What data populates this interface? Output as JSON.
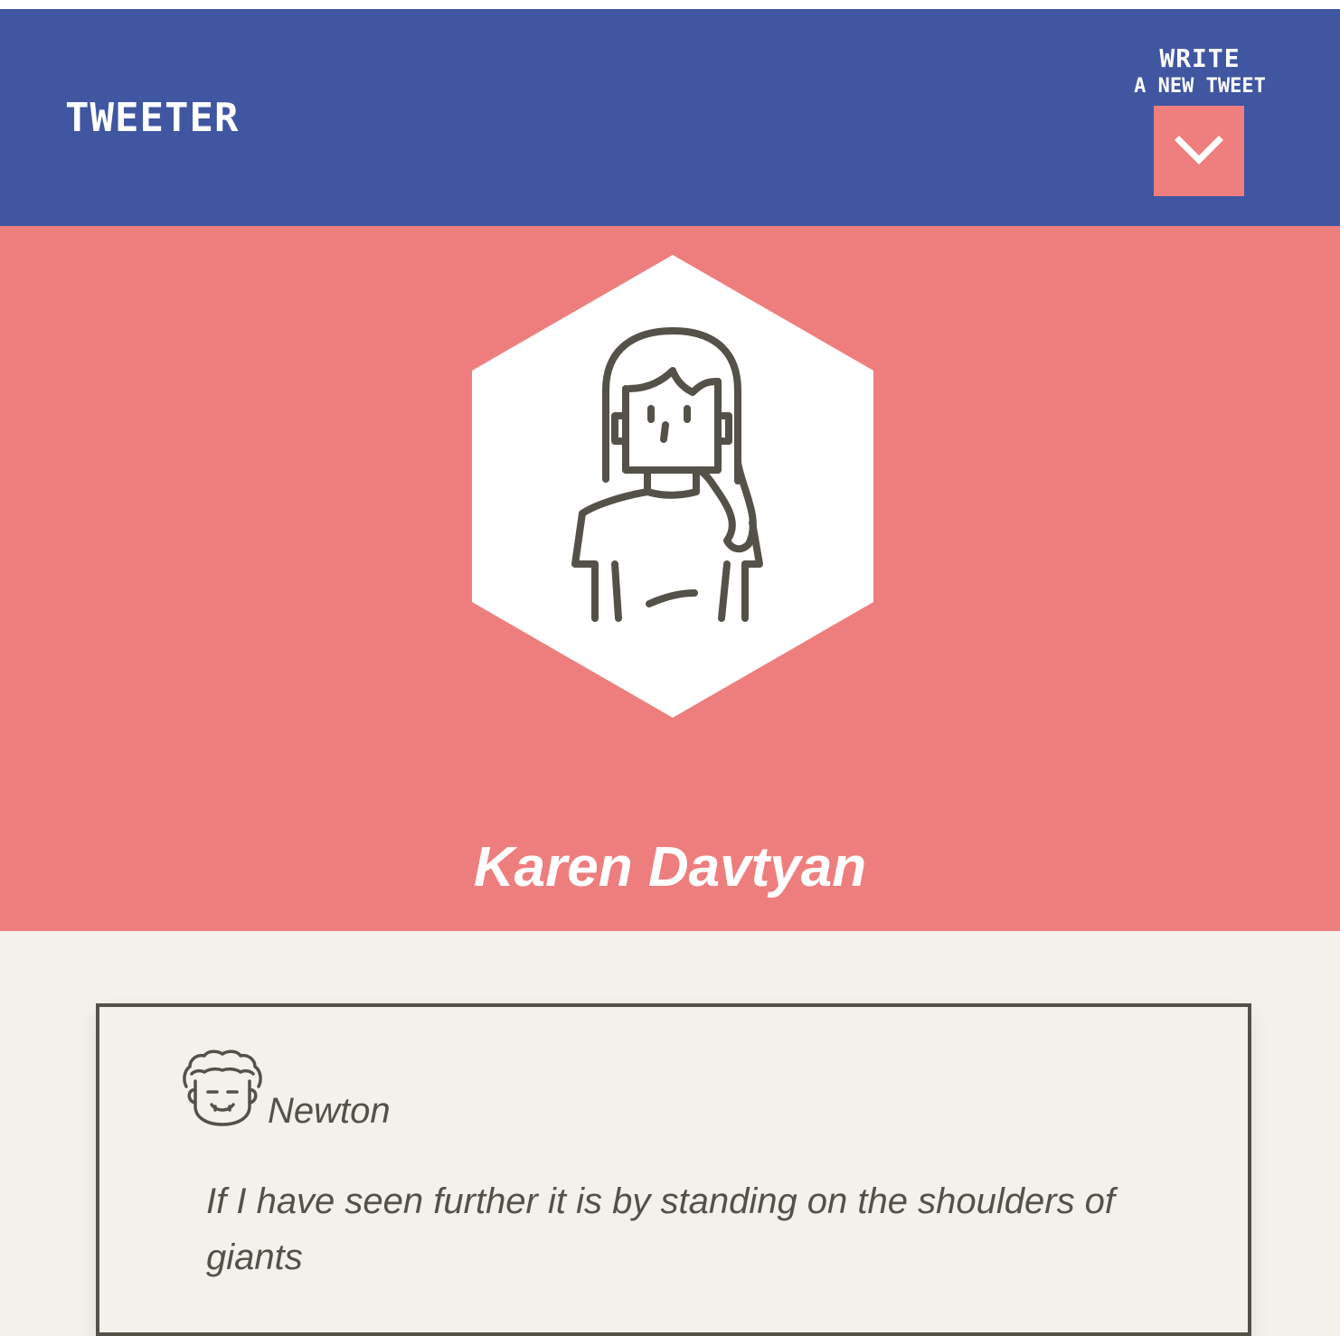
{
  "header": {
    "brand": "TWEETER",
    "compose_line1": "WRITE",
    "compose_line2": "A NEW TWEET",
    "compose_icon": "chevron-down-icon"
  },
  "profile": {
    "name": "Karen Davtyan",
    "avatar_icon": "woman-avatar-icon"
  },
  "tweets": [
    {
      "author": "Newton",
      "avatar_icon": "curly-hair-man-avatar-icon",
      "text": "If I have seen further it is by standing on the shoulders of giants"
    }
  ],
  "colors": {
    "navbar": "#4056a1",
    "accent": "#ee7e7e",
    "background": "#f4f1ec",
    "ink": "#545149"
  }
}
